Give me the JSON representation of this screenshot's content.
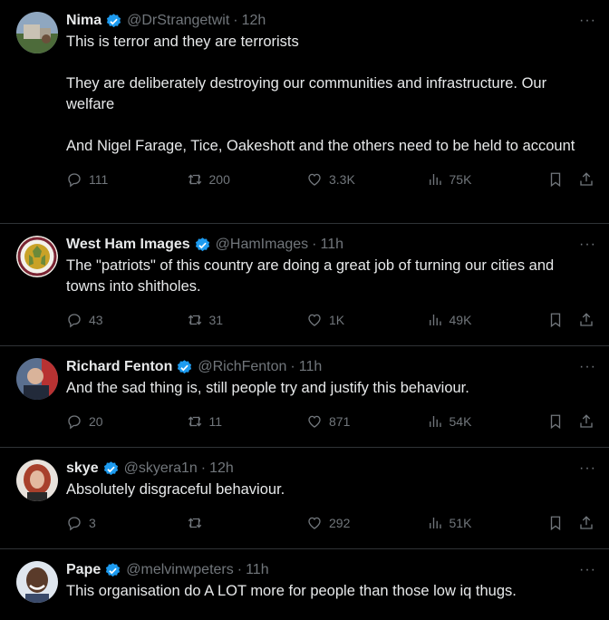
{
  "tweets": [
    {
      "name": "Nima",
      "handle": "@DrStrangetwit",
      "time": "12h",
      "text": "This is terror and they are terrorists\n\nThey are deliberately destroying our communities and infrastructure. Our welfare\n\nAnd Nigel Farage, Tice, Oakeshott and the others need to be held to account",
      "replies": "111",
      "reposts": "200",
      "likes": "3.3K",
      "views": "75K"
    },
    {
      "name": "West Ham Images",
      "handle": "@HamImages",
      "time": "11h",
      "text": "The \"patriots\" of this country are doing a great job of turning our cities and towns into shitholes.",
      "replies": "43",
      "reposts": "31",
      "likes": "1K",
      "views": "49K"
    },
    {
      "name": "Richard Fenton",
      "handle": "@RichFenton",
      "time": "11h",
      "text": "And the sad thing is, still people try and justify this behaviour.",
      "replies": "20",
      "reposts": "11",
      "likes": "871",
      "views": "54K"
    },
    {
      "name": "skye",
      "handle": "@skyera1n",
      "time": "12h",
      "text": "Absolutely disgraceful behaviour.",
      "replies": "3",
      "reposts": "",
      "likes": "292",
      "views": "51K"
    },
    {
      "name": "Pape",
      "handle": "@melvinwpeters",
      "time": "11h",
      "text": "This organisation do A LOT more for people than those low iq thugs.",
      "replies": "",
      "reposts": "",
      "likes": "",
      "views": ""
    }
  ],
  "ui": {
    "dot_separator": "·",
    "more_glyph": "···",
    "verified_color": "#1d9bf0",
    "muted_color": "#71767b"
  },
  "icons": [
    "reply-icon",
    "repost-icon",
    "like-icon",
    "views-icon",
    "bookmark-icon",
    "share-icon",
    "verified-badge-icon",
    "more-icon"
  ]
}
